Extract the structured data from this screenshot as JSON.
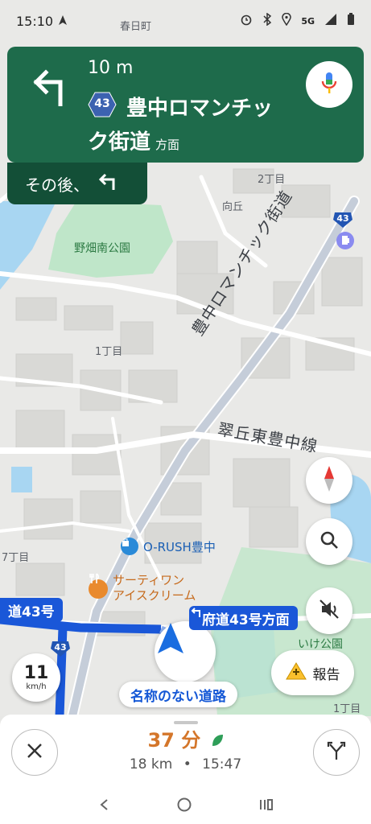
{
  "status_bar": {
    "time": "15:10",
    "network": "5G"
  },
  "navigation": {
    "distance": "10 m",
    "route_number": "43",
    "destination_line1": "豊中ロマンチッ",
    "destination_line2": "ク街道",
    "direction_suffix": "方面",
    "then_label": "その後、"
  },
  "map": {
    "labels": {
      "park": "野畑南公園",
      "district_2chome": "2丁目",
      "mukaioka": "向丘",
      "district_1chome": "1丁目",
      "road_romantic": "豊中ロマンチック街道",
      "road_suioka": "翠丘東豊中線",
      "store_orush": "O-RUSH豊中",
      "store_31_line1": "サーティワン",
      "store_31_line2": "アイスクリーム",
      "district_7chome": "7丁目",
      "ike_park": "いけ公園",
      "district_1chome_b": "1丁目",
      "kasugacho": "春日町",
      "shield_43": "43"
    },
    "route_tag_left": "道43号",
    "route_tag_right": "府道43号方面"
  },
  "controls": {
    "report_label": "報告",
    "speed_value": "11",
    "speed_unit": "km/h",
    "current_road": "名称のない道路"
  },
  "trip": {
    "eta_minutes": "37 分",
    "distance": "18 km",
    "separator": "•",
    "arrival_time": "15:47"
  },
  "colors": {
    "nav_green": "#1e6b4b",
    "route_blue": "#1a57d8",
    "eta_orange": "#d4762a"
  }
}
